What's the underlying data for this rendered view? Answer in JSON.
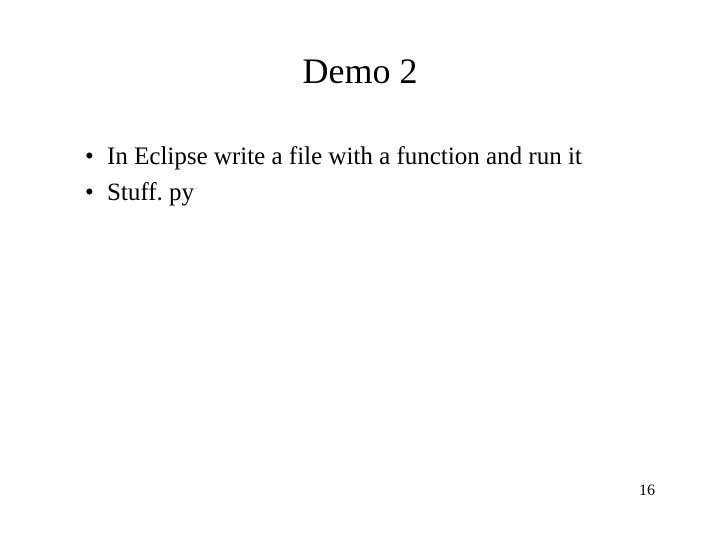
{
  "title": "Demo 2",
  "bullets": [
    "In Eclipse write a file with a function and run it",
    "Stuff. py"
  ],
  "pageNumber": "16"
}
